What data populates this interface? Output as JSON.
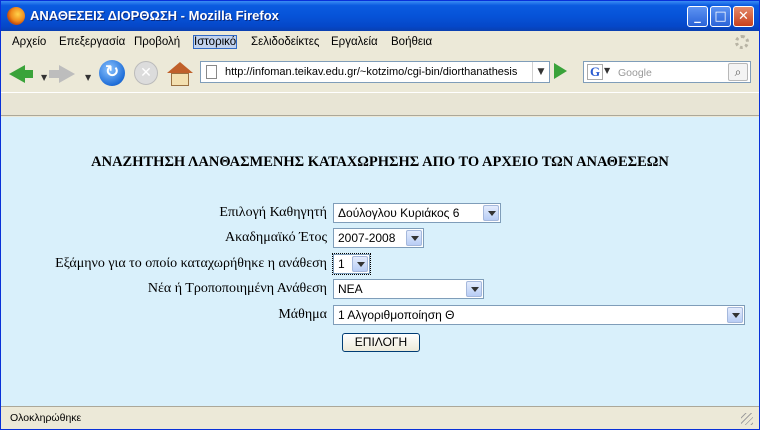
{
  "window": {
    "title": "ΑΝΑΘΕΣΕΙΣ ΔΙΟΡΘΩΣΗ - Mozilla Firefox"
  },
  "menu": [
    "Αρχείο",
    "Επεξεργασία",
    "Προβολή",
    "Ιστορικό",
    "Σελιδοδείκτες",
    "Εργαλεία",
    "Βοήθεια"
  ],
  "navigation": {
    "url": "http://infoman.teikav.edu.gr/~kotzimo/cgi-bin/diorthanathesis",
    "search_placeholder": "Google",
    "search_engine": "G"
  },
  "form": {
    "heading": "ΑΝΑΖΗΤΗΣΗ ΛΑΝΘΑΣΜΕΝΗΣ ΚΑΤΑΧΩΡΗΣΗΣ ΑΠΟ ΤΟ ΑΡΧΕΙΟ ΤΩΝ ΑΝΑΘΕΣΕΩΝ",
    "professor_label": "Επιλογή Καθηγητή",
    "professor_value": "Δούλογλου Κυριάκος 6",
    "year_label": "Ακαδημαϊκό Έτος",
    "year_value": "2007-2008",
    "semester_label": "Εξάμηνο για το οποίο καταχωρήθηκε η ανάθεση",
    "semester_value": "1",
    "type_label": "Νέα ή Τροποποιημένη Ανάθεση",
    "type_value": "ΝΕΑ",
    "course_label": "Μάθημα",
    "course_value": "1 Αλγοριθμοποίηση Θ",
    "submit": "ΕΠΙΛΟΓΗ"
  },
  "status": "Ολοκληρώθηκε"
}
